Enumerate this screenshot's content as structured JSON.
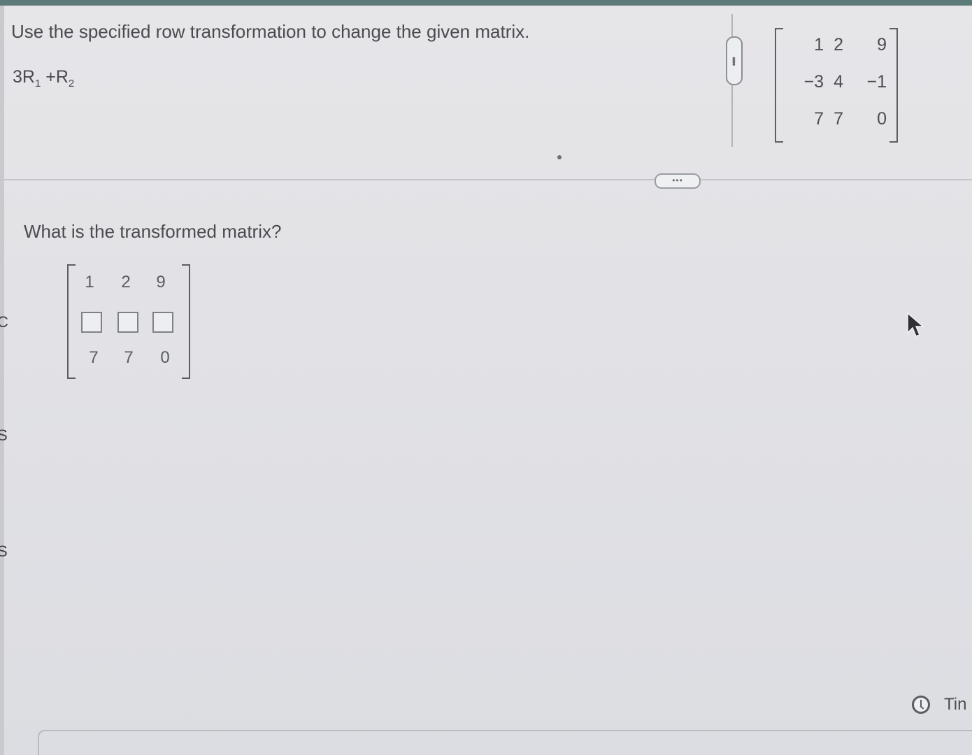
{
  "instruction": "Use the specified row transformation to change the given matrix.",
  "transformation": {
    "coefficient": "3R",
    "sub1": "1",
    "plus": " +R",
    "sub2": "2"
  },
  "given_matrix": {
    "rows": [
      [
        "1",
        "2",
        "9"
      ],
      [
        "−3",
        "4",
        "−1"
      ],
      [
        "7",
        "7",
        "0"
      ]
    ]
  },
  "question": "What is the transformed matrix?",
  "answer_matrix": {
    "row1": [
      "1",
      "2",
      "9"
    ],
    "row2_inputs": [
      "",
      "",
      ""
    ],
    "row3": [
      "7",
      "7",
      "0"
    ]
  },
  "more_button_label": "•••",
  "scroll_pill_label": "••••",
  "timer_label": "Tin",
  "edge_letters": [
    "C",
    "S",
    "S"
  ],
  "icons": {
    "timer": "clock-icon",
    "pointer": "cursor-arrow-icon"
  },
  "colors": {
    "top_strip": "#5d7b78",
    "text": "#4a4b50",
    "background": "#e2e2e6"
  }
}
